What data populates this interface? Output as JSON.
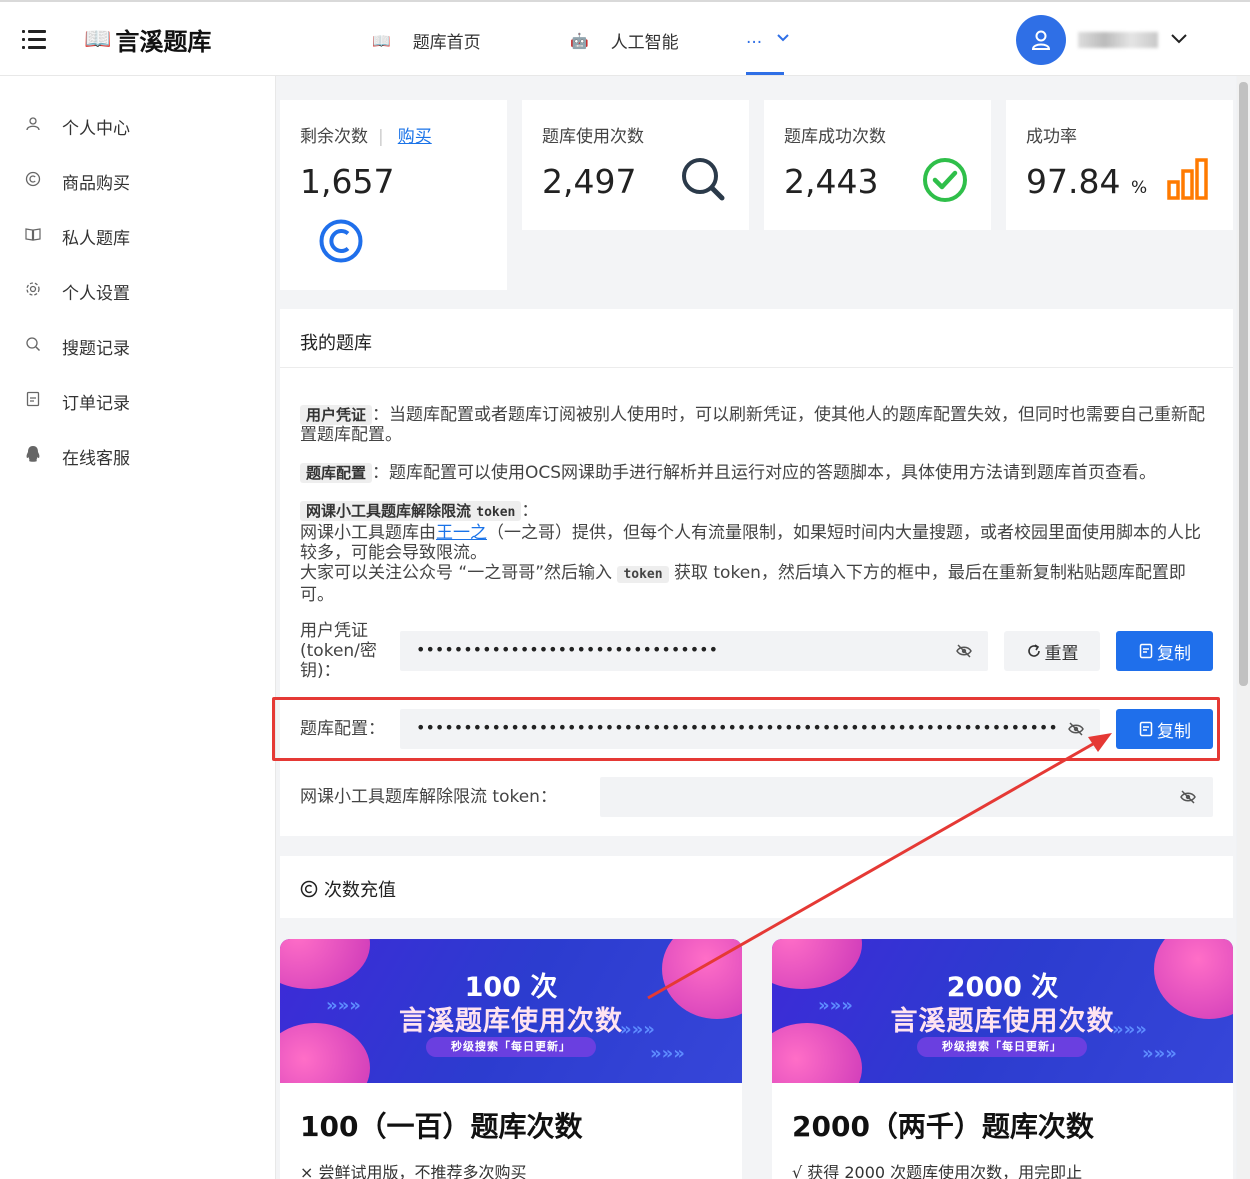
{
  "header": {
    "logo_text": "言溪题库",
    "nav": [
      {
        "label": "题库首页",
        "icon": "book-icon"
      },
      {
        "label": "人工智能",
        "icon": "robot-icon"
      }
    ],
    "more_label": "...",
    "accent": "#2f6fe6"
  },
  "sidebar": {
    "items": [
      {
        "label": "个人中心",
        "icon": "user-icon"
      },
      {
        "label": "商品购买",
        "icon": "copyright-icon"
      },
      {
        "label": "私人题库",
        "icon": "book-icon"
      },
      {
        "label": "个人设置",
        "icon": "gear-icon"
      },
      {
        "label": "搜题记录",
        "icon": "search-icon"
      },
      {
        "label": "订单记录",
        "icon": "document-icon"
      },
      {
        "label": "在线客服",
        "icon": "qq-icon"
      }
    ]
  },
  "stats": [
    {
      "label": "剩余次数",
      "value": "1,657",
      "link": "购买",
      "icon": "copyright-icon"
    },
    {
      "label": "题库使用次数",
      "value": "2,497",
      "icon": "search-icon"
    },
    {
      "label": "题库成功次数",
      "value": "2,443",
      "icon": "check-circle-icon"
    },
    {
      "label": "成功率",
      "value": "97.84",
      "unit": "%",
      "icon": "bar-chart-icon"
    }
  ],
  "my_bank": {
    "title": "我的题库",
    "p1_tag": "用户凭证",
    "p1_text": "：当题库配置或者题库订阅被别人使用时，可以刷新凭证，使其他人的题库配置失效，但同时也需要自己重新配置题库配置。",
    "p2_tag": "题库配置",
    "p2_text": "：题库配置可以使用OCS网课助手进行解析并且运行对应的答题脚本，具体使用方法请到题库首页查看。",
    "p3_tag": "网课小工具题库解除限流",
    "p3_tag_token": "token",
    "p3_colon": "：",
    "p3_line1_a": "网课小工具题库由",
    "p3_link": "王一之",
    "p3_line1_b": "（一之哥）提供，但每个人有流量限制，如果短时间内大量搜题，或者校园里面使用脚本的人比较多，可能会导致限流。",
    "p3_line2_a": "大家可以关注公众号 “一之哥哥”然后输入",
    "p3_line2_token": "token",
    "p3_line2_b": "获取 token，然后填入下方的框中，最后在重新复制粘贴题库配置即可。",
    "field_token_label": "用户凭证 (token/密钥)：",
    "field_token_value": "••••••••••••••••••••••••••••••••",
    "reset_label": "重置",
    "copy_label": "复制",
    "field_config_label": "题库配置：",
    "field_config_value": "•••••••••••••••••••••••••••••••••••••••••••••••••••••••••••••••••••••••••••••••••••",
    "field_limit_label": "网课小工具题库解除限流 token：",
    "field_limit_value": ""
  },
  "recharge": {
    "title": "次数充值",
    "products": [
      {
        "banner_count": "100 次",
        "banner_title": "言溪题库使用次数",
        "banner_pill": "秒级搜索「每日更新」",
        "title": "100（一百）题库次数",
        "sub": "× 尝鲜试用版，不推荐多次购买"
      },
      {
        "banner_count": "2000 次",
        "banner_title": "言溪题库使用次数",
        "banner_pill": "秒级搜索「每日更新」",
        "title": "2000（两千）题库次数",
        "sub": "√ 获得 2000 次题库使用次数，用完即止"
      }
    ]
  },
  "colors": {
    "primary": "#1f6feb",
    "success": "#2fbf4a",
    "warning": "#ff7a00",
    "highlight": "#e53935"
  }
}
